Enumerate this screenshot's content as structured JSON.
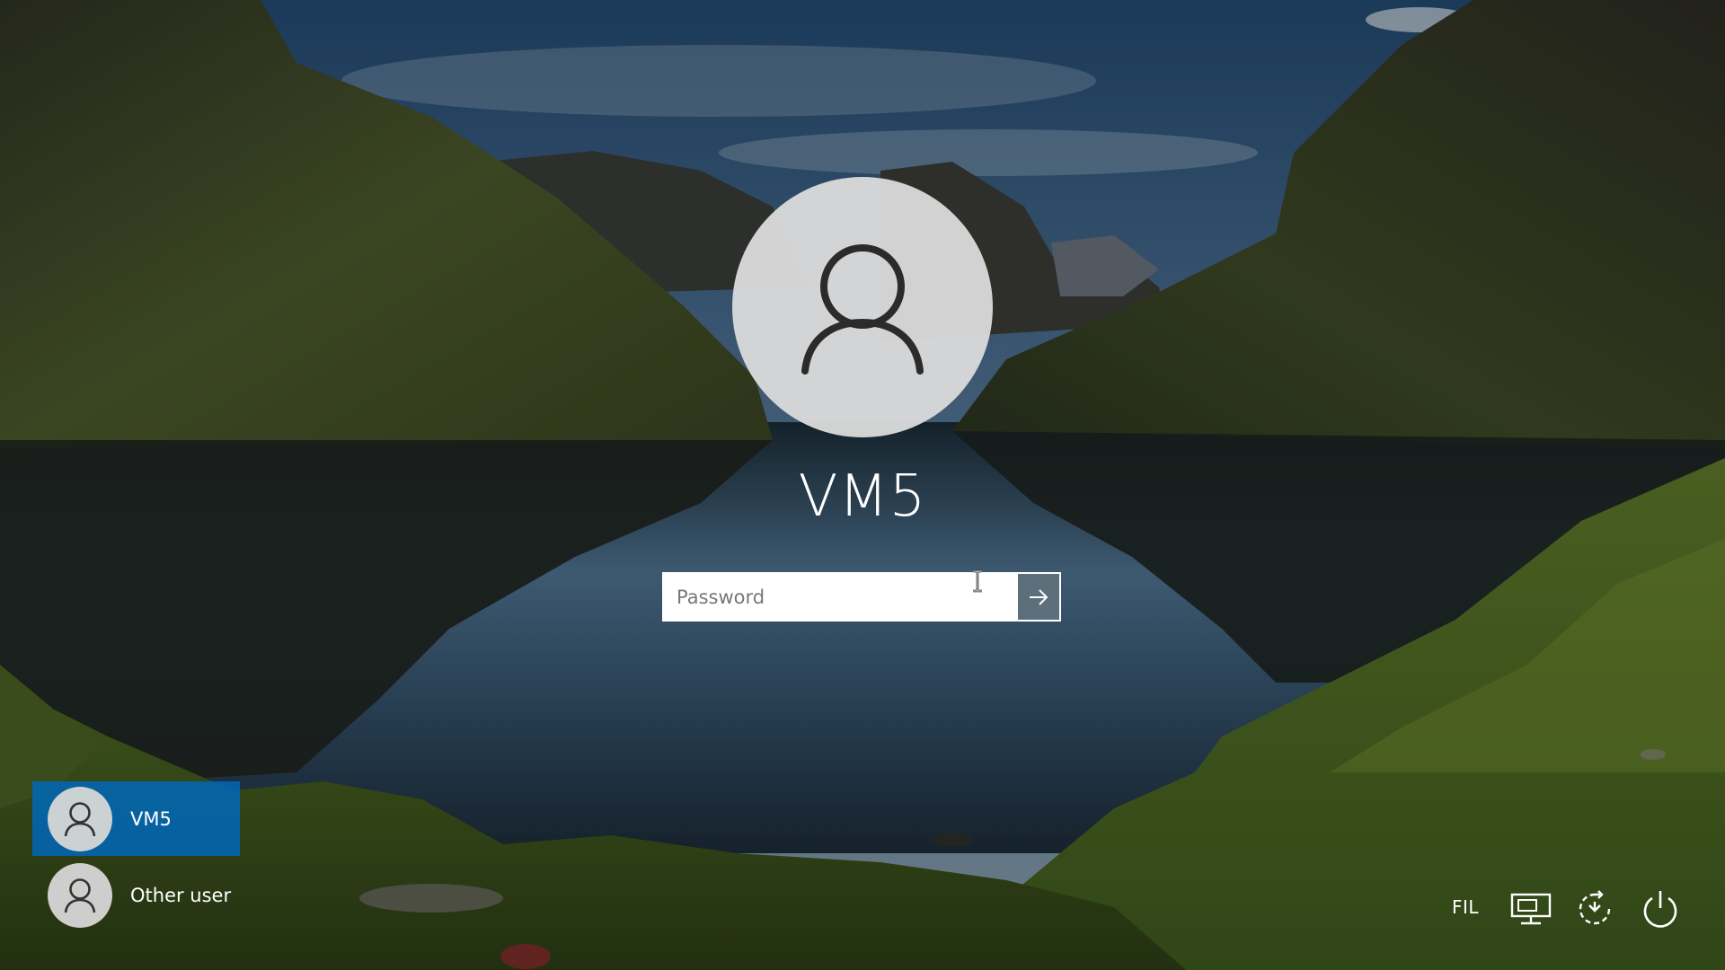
{
  "login": {
    "user_name": "VM5",
    "password_placeholder": "Password",
    "password_value": "",
    "submit_icon": "arrow-right-icon"
  },
  "users": [
    {
      "label": "VM5",
      "selected": true,
      "icon": "user-icon"
    },
    {
      "label": "Other user",
      "selected": false,
      "icon": "user-icon"
    }
  ],
  "tray": {
    "language": "FIL",
    "icons": [
      "network-icon",
      "ease-of-access-icon",
      "power-icon"
    ]
  },
  "colors": {
    "selected_tile": "#0067b8",
    "avatar_bg": "#dadada",
    "submit_button": "#5d6f7a",
    "text": "#ffffff"
  }
}
